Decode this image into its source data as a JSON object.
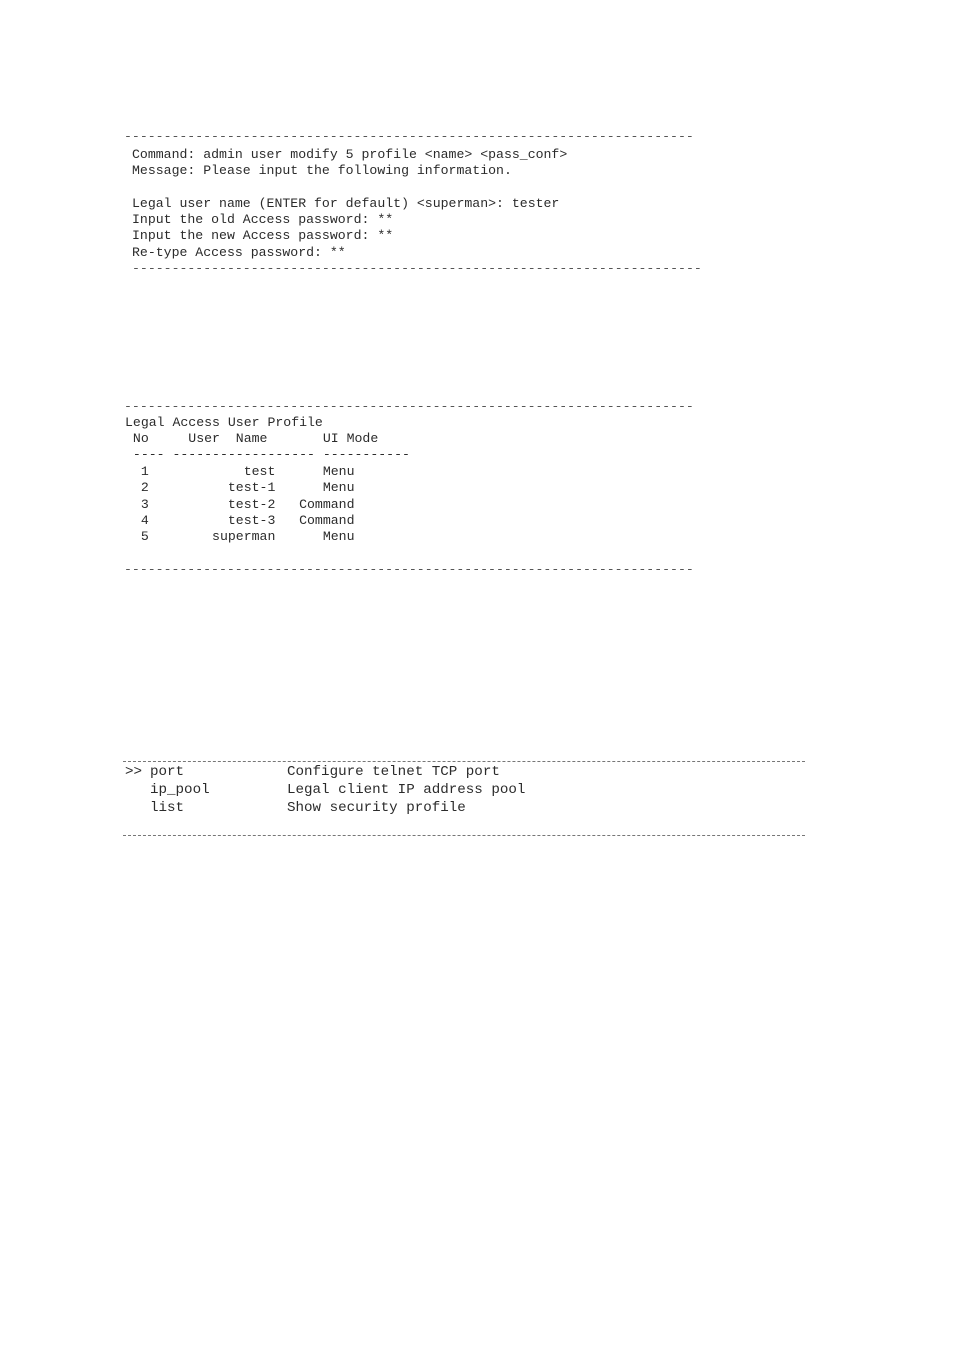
{
  "screen1": {
    "separator": "------------------------------------------------------------------------",
    "command_line": "Command: admin user modify 5 profile <name> <pass_conf>",
    "message_line": "Message: Please input the following information.",
    "prompts": [
      "Legal user name (ENTER for default) <superman>: tester",
      "Input the old Access password: **",
      "Input the new Access password: **",
      "Re-type Access password: **"
    ]
  },
  "screen2": {
    "separator": "------------------------------------------------------------------------",
    "title": "Legal Access User Profile",
    "header_line": " No     User  Name       UI Mode",
    "underline": " ---- ------------------ -----------",
    "columns": [
      "No",
      "User Name",
      "UI Mode"
    ],
    "rows": [
      {
        "no": "1",
        "name": "test",
        "mode": "Menu",
        "text": "  1            test      Menu"
      },
      {
        "no": "2",
        "name": "test-1",
        "mode": "Menu",
        "text": "  2          test-1      Menu"
      },
      {
        "no": "3",
        "name": "test-2",
        "mode": "Command",
        "text": "  3          test-2   Command"
      },
      {
        "no": "4",
        "name": "test-3",
        "mode": "Command",
        "text": "  4          test-3   Command"
      },
      {
        "no": "5",
        "name": "superman",
        "mode": "Menu",
        "text": "  5        superman      Menu"
      }
    ]
  },
  "screen3": {
    "selector": ">>",
    "items": [
      {
        "command": "port",
        "description": "Configure telnet TCP port",
        "selected": true
      },
      {
        "command": "ip_pool",
        "description": "Legal client IP address pool",
        "selected": false
      },
      {
        "command": "list",
        "description": "Show security profile",
        "selected": false
      }
    ]
  }
}
